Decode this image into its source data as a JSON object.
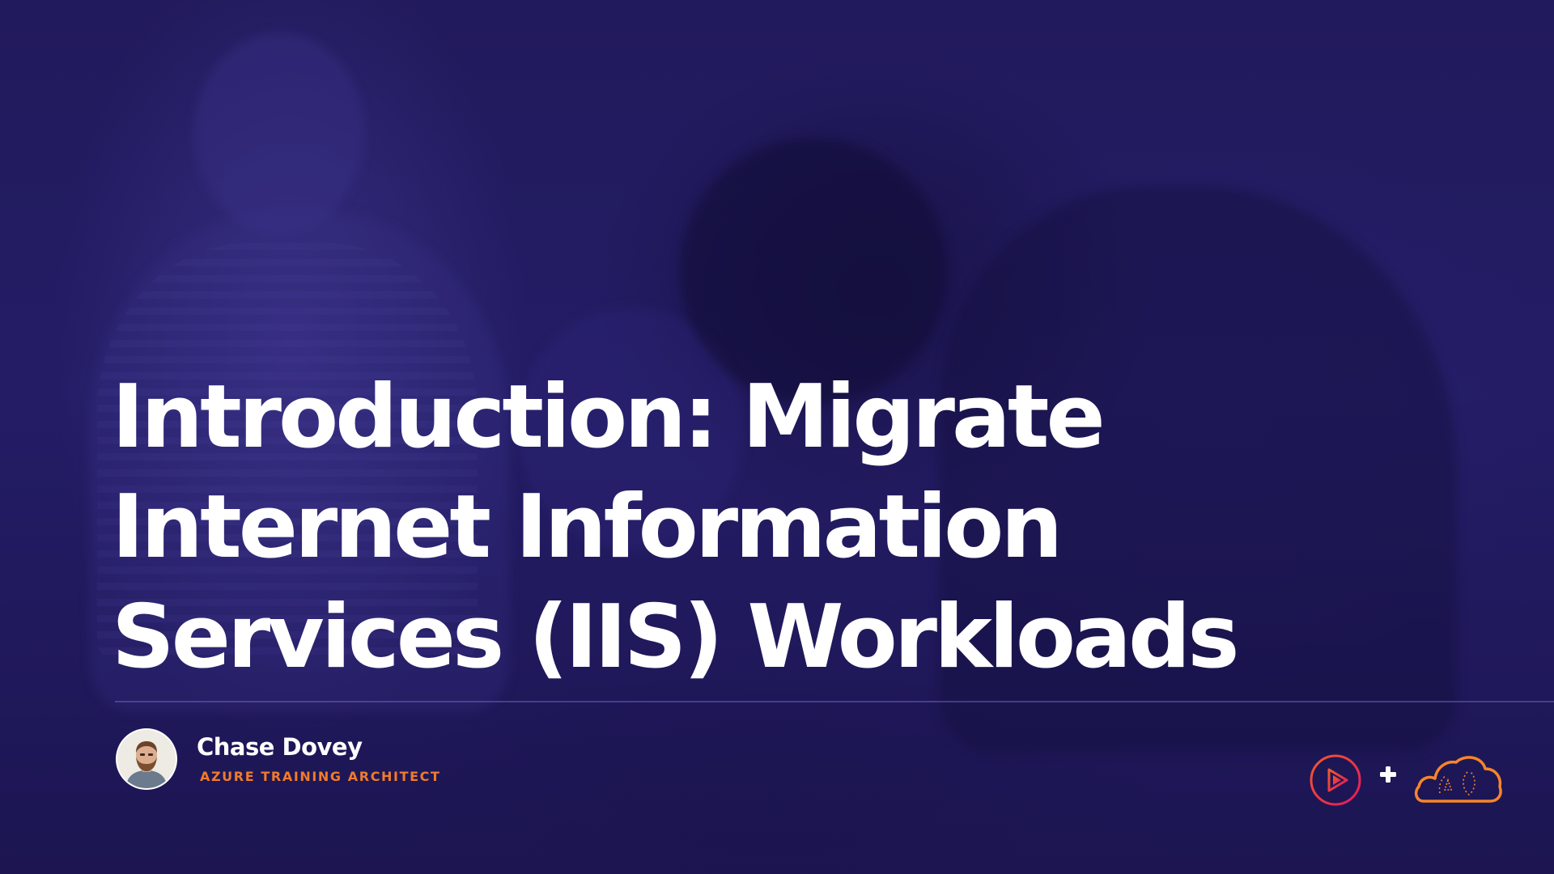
{
  "slide": {
    "title": "Introduction: Migrate Internet Information Services (IIS) Workloads",
    "author": {
      "name": "Chase Dovey",
      "role": "AZURE TRAINING ARCHITECT"
    },
    "logos": {
      "left": "play-circle-logo-icon",
      "separator": "plus-icon",
      "right": "cloud-logo-icon"
    }
  },
  "colors": {
    "background": "#221b60",
    "title": "#ffffff",
    "role_accent": "#f07b2b",
    "logo_pink": "#e8205f",
    "logo_orange": "#f6852b",
    "divider": "#5a52a6"
  }
}
